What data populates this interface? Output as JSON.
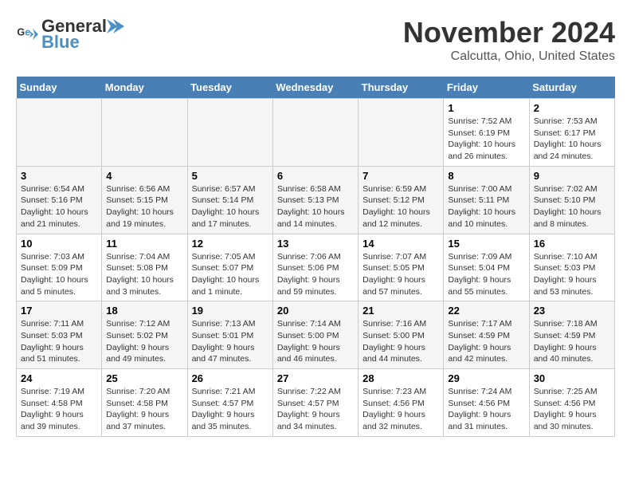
{
  "logo": {
    "line1": "General",
    "line2": "Blue"
  },
  "title": "November 2024",
  "subtitle": "Calcutta, Ohio, United States",
  "days_of_week": [
    "Sunday",
    "Monday",
    "Tuesday",
    "Wednesday",
    "Thursday",
    "Friday",
    "Saturday"
  ],
  "weeks": [
    [
      {
        "day": "",
        "info": ""
      },
      {
        "day": "",
        "info": ""
      },
      {
        "day": "",
        "info": ""
      },
      {
        "day": "",
        "info": ""
      },
      {
        "day": "",
        "info": ""
      },
      {
        "day": "1",
        "info": "Sunrise: 7:52 AM\nSunset: 6:19 PM\nDaylight: 10 hours and 26 minutes."
      },
      {
        "day": "2",
        "info": "Sunrise: 7:53 AM\nSunset: 6:17 PM\nDaylight: 10 hours and 24 minutes."
      }
    ],
    [
      {
        "day": "3",
        "info": "Sunrise: 6:54 AM\nSunset: 5:16 PM\nDaylight: 10 hours and 21 minutes."
      },
      {
        "day": "4",
        "info": "Sunrise: 6:56 AM\nSunset: 5:15 PM\nDaylight: 10 hours and 19 minutes."
      },
      {
        "day": "5",
        "info": "Sunrise: 6:57 AM\nSunset: 5:14 PM\nDaylight: 10 hours and 17 minutes."
      },
      {
        "day": "6",
        "info": "Sunrise: 6:58 AM\nSunset: 5:13 PM\nDaylight: 10 hours and 14 minutes."
      },
      {
        "day": "7",
        "info": "Sunrise: 6:59 AM\nSunset: 5:12 PM\nDaylight: 10 hours and 12 minutes."
      },
      {
        "day": "8",
        "info": "Sunrise: 7:00 AM\nSunset: 5:11 PM\nDaylight: 10 hours and 10 minutes."
      },
      {
        "day": "9",
        "info": "Sunrise: 7:02 AM\nSunset: 5:10 PM\nDaylight: 10 hours and 8 minutes."
      }
    ],
    [
      {
        "day": "10",
        "info": "Sunrise: 7:03 AM\nSunset: 5:09 PM\nDaylight: 10 hours and 5 minutes."
      },
      {
        "day": "11",
        "info": "Sunrise: 7:04 AM\nSunset: 5:08 PM\nDaylight: 10 hours and 3 minutes."
      },
      {
        "day": "12",
        "info": "Sunrise: 7:05 AM\nSunset: 5:07 PM\nDaylight: 10 hours and 1 minute."
      },
      {
        "day": "13",
        "info": "Sunrise: 7:06 AM\nSunset: 5:06 PM\nDaylight: 9 hours and 59 minutes."
      },
      {
        "day": "14",
        "info": "Sunrise: 7:07 AM\nSunset: 5:05 PM\nDaylight: 9 hours and 57 minutes."
      },
      {
        "day": "15",
        "info": "Sunrise: 7:09 AM\nSunset: 5:04 PM\nDaylight: 9 hours and 55 minutes."
      },
      {
        "day": "16",
        "info": "Sunrise: 7:10 AM\nSunset: 5:03 PM\nDaylight: 9 hours and 53 minutes."
      }
    ],
    [
      {
        "day": "17",
        "info": "Sunrise: 7:11 AM\nSunset: 5:03 PM\nDaylight: 9 hours and 51 minutes."
      },
      {
        "day": "18",
        "info": "Sunrise: 7:12 AM\nSunset: 5:02 PM\nDaylight: 9 hours and 49 minutes."
      },
      {
        "day": "19",
        "info": "Sunrise: 7:13 AM\nSunset: 5:01 PM\nDaylight: 9 hours and 47 minutes."
      },
      {
        "day": "20",
        "info": "Sunrise: 7:14 AM\nSunset: 5:00 PM\nDaylight: 9 hours and 46 minutes."
      },
      {
        "day": "21",
        "info": "Sunrise: 7:16 AM\nSunset: 5:00 PM\nDaylight: 9 hours and 44 minutes."
      },
      {
        "day": "22",
        "info": "Sunrise: 7:17 AM\nSunset: 4:59 PM\nDaylight: 9 hours and 42 minutes."
      },
      {
        "day": "23",
        "info": "Sunrise: 7:18 AM\nSunset: 4:59 PM\nDaylight: 9 hours and 40 minutes."
      }
    ],
    [
      {
        "day": "24",
        "info": "Sunrise: 7:19 AM\nSunset: 4:58 PM\nDaylight: 9 hours and 39 minutes."
      },
      {
        "day": "25",
        "info": "Sunrise: 7:20 AM\nSunset: 4:58 PM\nDaylight: 9 hours and 37 minutes."
      },
      {
        "day": "26",
        "info": "Sunrise: 7:21 AM\nSunset: 4:57 PM\nDaylight: 9 hours and 35 minutes."
      },
      {
        "day": "27",
        "info": "Sunrise: 7:22 AM\nSunset: 4:57 PM\nDaylight: 9 hours and 34 minutes."
      },
      {
        "day": "28",
        "info": "Sunrise: 7:23 AM\nSunset: 4:56 PM\nDaylight: 9 hours and 32 minutes."
      },
      {
        "day": "29",
        "info": "Sunrise: 7:24 AM\nSunset: 4:56 PM\nDaylight: 9 hours and 31 minutes."
      },
      {
        "day": "30",
        "info": "Sunrise: 7:25 AM\nSunset: 4:56 PM\nDaylight: 9 hours and 30 minutes."
      }
    ]
  ]
}
